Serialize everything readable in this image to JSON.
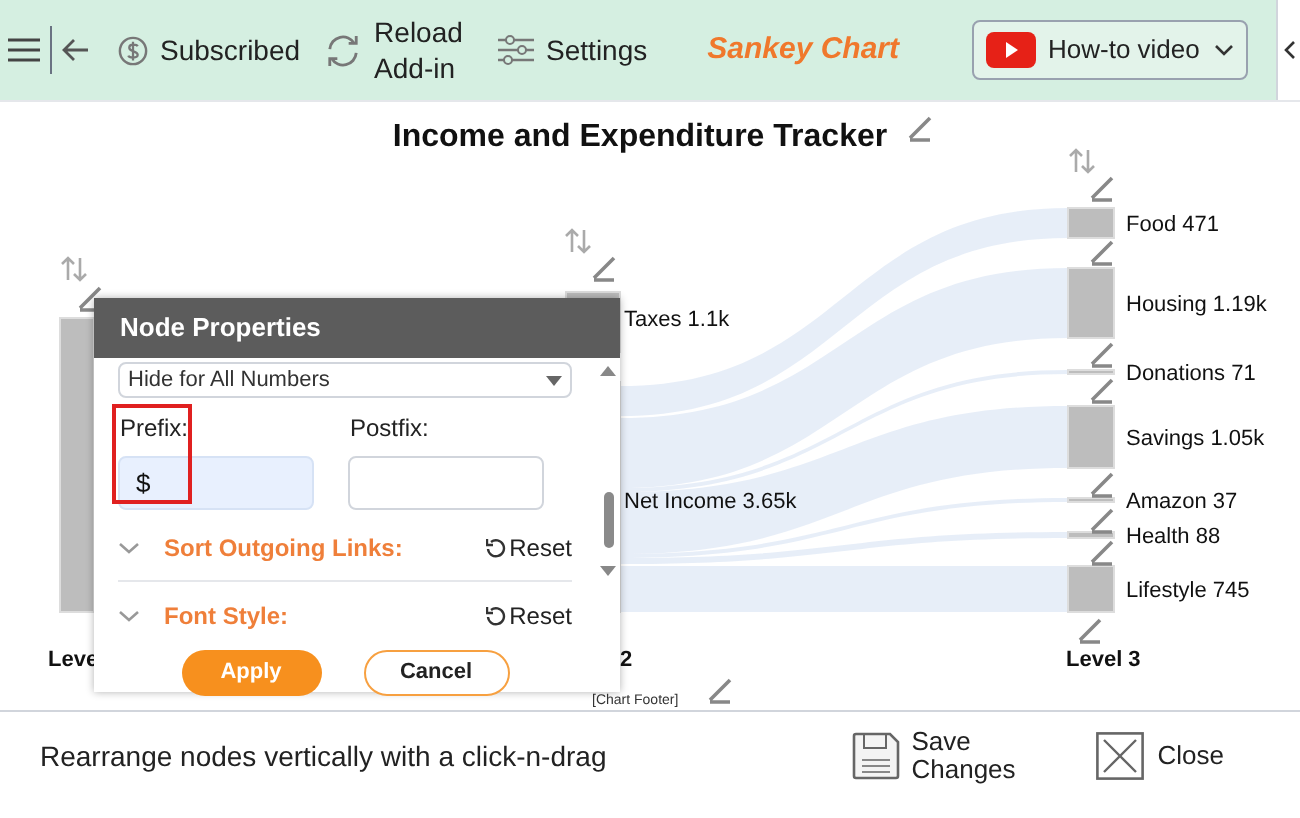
{
  "toolbar": {
    "items": [
      {
        "kind": "subscription",
        "label": "Subscribed"
      },
      {
        "kind": "reload",
        "label": "Reload Add-in"
      },
      {
        "kind": "settings",
        "label": "Settings"
      }
    ],
    "app_title": "Sankey Chart",
    "video_button": "How-to video"
  },
  "chart": {
    "title": "Income and Expenditure Tracker",
    "footer": "[Chart Footer]",
    "level_labels": [
      "Leve",
      "2",
      "Level 3"
    ],
    "middle_nodes": [
      {
        "label": "Taxes 1.1k"
      },
      {
        "label": "Net Income 3.65k"
      }
    ],
    "end_nodes": [
      {
        "label": "Food 471"
      },
      {
        "label": "Housing 1.19k"
      },
      {
        "label": "Donations 71"
      },
      {
        "label": "Savings 1.05k"
      },
      {
        "label": "Amazon 37"
      },
      {
        "label": "Health 88"
      },
      {
        "label": "Lifestyle 745"
      }
    ]
  },
  "dialog": {
    "title": "Node Properties",
    "select_value": "Hide for All Numbers",
    "prefix": {
      "label": "Prefix:",
      "value": "$",
      "highlighted": true
    },
    "postfix": {
      "label": "Postfix:"
    },
    "sections": [
      {
        "label": "Sort Outgoing Links:",
        "expanded": false,
        "reset": "Reset"
      },
      {
        "label": "Font Style:",
        "expanded": false,
        "reset": "Reset"
      }
    ],
    "apply": "Apply",
    "cancel": "Cancel"
  },
  "status_bar": {
    "hint": "Rearrange nodes vertically with a click-n-drag",
    "save": "Save Changes",
    "close": "Close"
  }
}
